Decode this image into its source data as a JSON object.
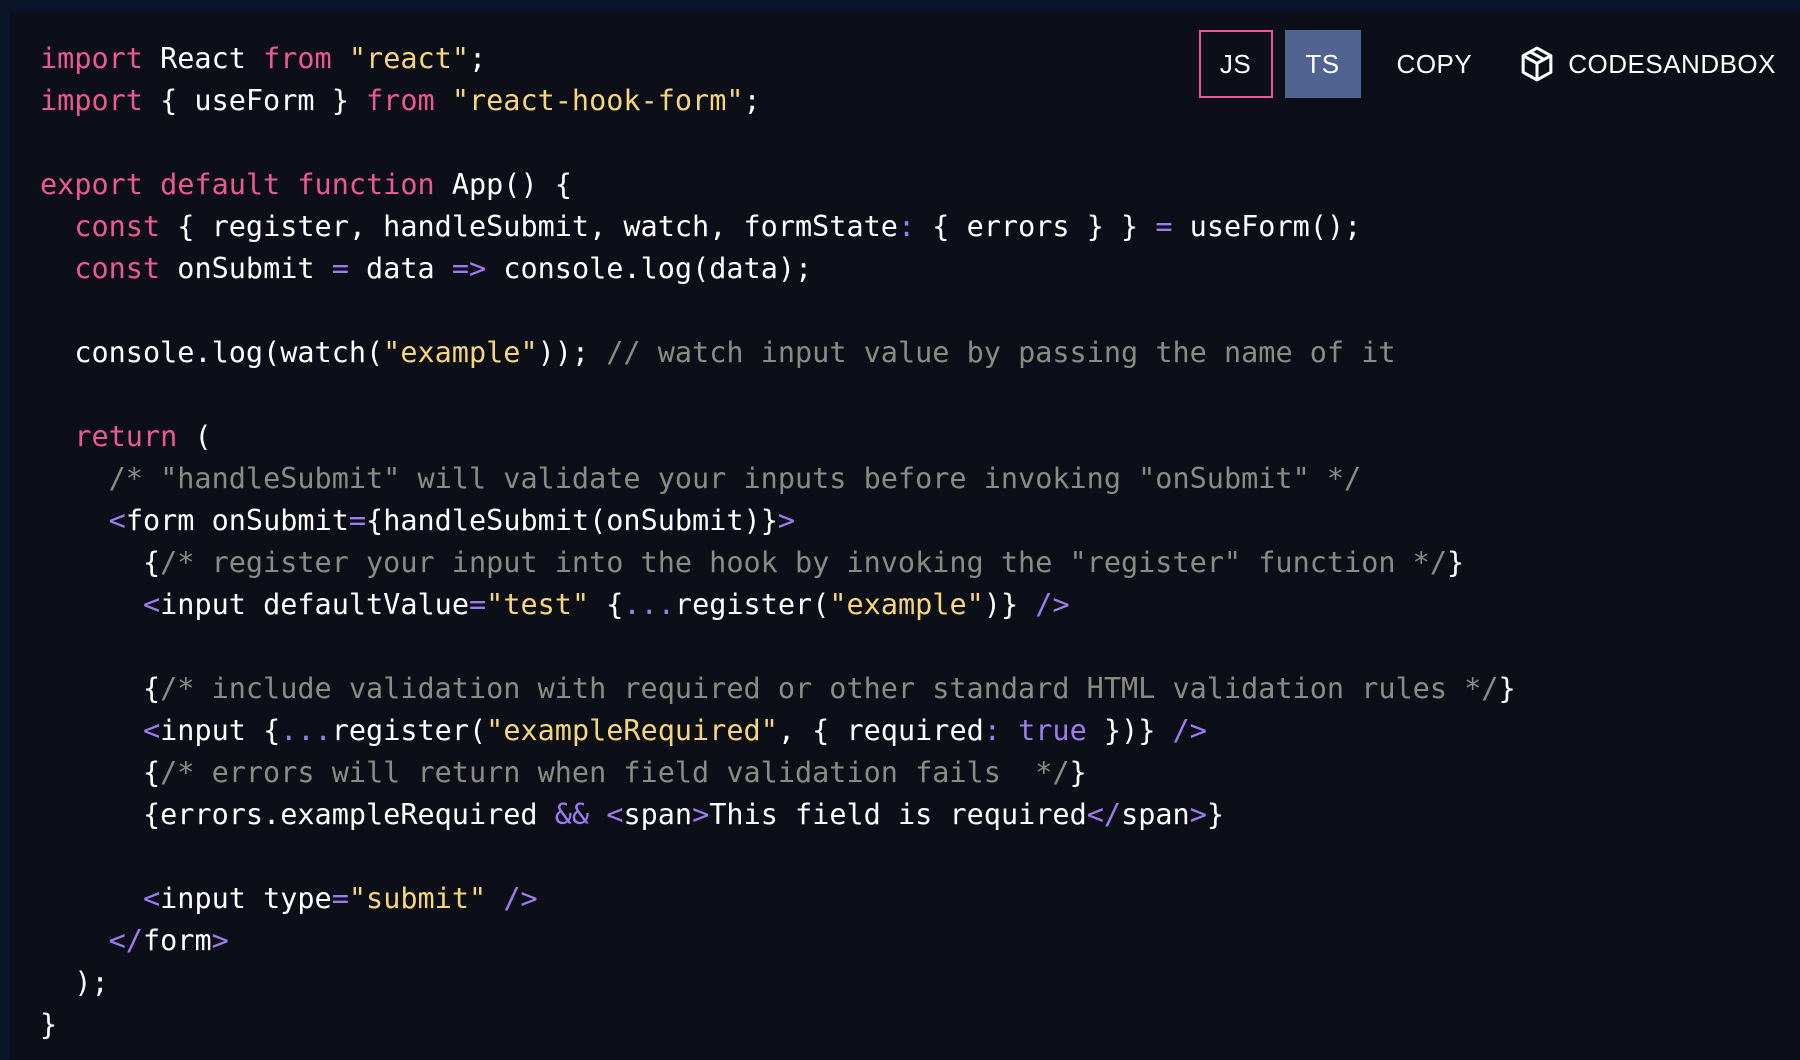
{
  "toolbar": {
    "js_label": "JS",
    "ts_label": "TS",
    "copy_label": "COPY",
    "sandbox_label": "CODESANDBOX",
    "sandbox_icon": "cube-icon"
  },
  "colors": {
    "background": "#0d0f18",
    "keyword": "#ec5990",
    "string": "#f5d67b",
    "operator": "#9e7cf0",
    "comment": "#8b8b84",
    "active_tab": "#516391"
  },
  "code": {
    "language": "jsx",
    "lines": [
      [
        [
          "kw",
          "import"
        ],
        [
          "pl",
          " React "
        ],
        [
          "kw",
          "from"
        ],
        [
          "pl",
          " "
        ],
        [
          "st",
          "\"react\""
        ],
        [
          "pl",
          ";"
        ]
      ],
      [
        [
          "kw",
          "import"
        ],
        [
          "pl",
          " { useForm } "
        ],
        [
          "kw",
          "from"
        ],
        [
          "pl",
          " "
        ],
        [
          "st",
          "\"react-hook-form\""
        ],
        [
          "pl",
          ";"
        ]
      ],
      [],
      [
        [
          "kw",
          "export default function"
        ],
        [
          "pl",
          " App() {"
        ]
      ],
      [
        [
          "pl",
          "  "
        ],
        [
          "kw",
          "const"
        ],
        [
          "pl",
          " { register, handleSubmit, watch, formState"
        ],
        [
          "op",
          ":"
        ],
        [
          "pl",
          " { errors } } "
        ],
        [
          "op",
          "="
        ],
        [
          "pl",
          " useForm();"
        ]
      ],
      [
        [
          "pl",
          "  "
        ],
        [
          "kw",
          "const"
        ],
        [
          "pl",
          " onSubmit "
        ],
        [
          "op",
          "="
        ],
        [
          "pl",
          " data "
        ],
        [
          "op",
          "=>"
        ],
        [
          "pl",
          " console.log(data);"
        ]
      ],
      [],
      [
        [
          "pl",
          "  console.log(watch("
        ],
        [
          "st",
          "\"example\""
        ],
        [
          "pl",
          "));"
        ],
        [
          "pl",
          " "
        ],
        [
          "cm",
          "// watch input value by passing the name of it"
        ]
      ],
      [],
      [
        [
          "pl",
          "  "
        ],
        [
          "kw",
          "return"
        ],
        [
          "pl",
          " ("
        ]
      ],
      [
        [
          "pl",
          "    "
        ],
        [
          "cm",
          "/* \"handleSubmit\" will validate your inputs before invoking \"onSubmit\" */"
        ]
      ],
      [
        [
          "pl",
          "    "
        ],
        [
          "op",
          "<"
        ],
        [
          "pl",
          "form onSubmit"
        ],
        [
          "op",
          "="
        ],
        [
          "pl",
          "{handleSubmit(onSubmit)}"
        ],
        [
          "op",
          ">"
        ]
      ],
      [
        [
          "pl",
          "      {"
        ],
        [
          "cm",
          "/* register your input into the hook by invoking the \"register\" function */"
        ],
        [
          "pl",
          "}"
        ]
      ],
      [
        [
          "pl",
          "      "
        ],
        [
          "op",
          "<"
        ],
        [
          "pl",
          "input defaultValue"
        ],
        [
          "op",
          "="
        ],
        [
          "st",
          "\"test\""
        ],
        [
          "pl",
          " {"
        ],
        [
          "op",
          "..."
        ],
        [
          "pl",
          "register("
        ],
        [
          "st",
          "\"example\""
        ],
        [
          "pl",
          ")} "
        ],
        [
          "op",
          "/>"
        ]
      ],
      [],
      [
        [
          "pl",
          "      {"
        ],
        [
          "cm",
          "/* include validation with required or other standard HTML validation rules */"
        ],
        [
          "pl",
          "}"
        ]
      ],
      [
        [
          "pl",
          "      "
        ],
        [
          "op",
          "<"
        ],
        [
          "pl",
          "input {"
        ],
        [
          "op",
          "..."
        ],
        [
          "pl",
          "register("
        ],
        [
          "st",
          "\"exampleRequired\""
        ],
        [
          "pl",
          ", { required"
        ],
        [
          "op",
          ":"
        ],
        [
          "pl",
          " "
        ],
        [
          "bool",
          "true"
        ],
        [
          "pl",
          " })} "
        ],
        [
          "op",
          "/>"
        ]
      ],
      [
        [
          "pl",
          "      {"
        ],
        [
          "cm",
          "/* errors will return when field validation fails  */"
        ],
        [
          "pl",
          "}"
        ]
      ],
      [
        [
          "pl",
          "      {errors.exampleRequired "
        ],
        [
          "op",
          "&&"
        ],
        [
          "pl",
          " "
        ],
        [
          "op",
          "<"
        ],
        [
          "pl",
          "span"
        ],
        [
          "op",
          ">"
        ],
        [
          "pl",
          "This field is required"
        ],
        [
          "op",
          "</"
        ],
        [
          "pl",
          "span"
        ],
        [
          "op",
          ">"
        ],
        [
          "pl",
          "}"
        ]
      ],
      [],
      [
        [
          "pl",
          "      "
        ],
        [
          "op",
          "<"
        ],
        [
          "pl",
          "input type"
        ],
        [
          "op",
          "="
        ],
        [
          "st",
          "\"submit\""
        ],
        [
          "pl",
          " "
        ],
        [
          "op",
          "/>"
        ]
      ],
      [
        [
          "pl",
          "    "
        ],
        [
          "op",
          "</"
        ],
        [
          "pl",
          "form"
        ],
        [
          "op",
          ">"
        ]
      ],
      [
        [
          "pl",
          "  );"
        ]
      ],
      [
        [
          "pl",
          "}"
        ]
      ]
    ]
  }
}
